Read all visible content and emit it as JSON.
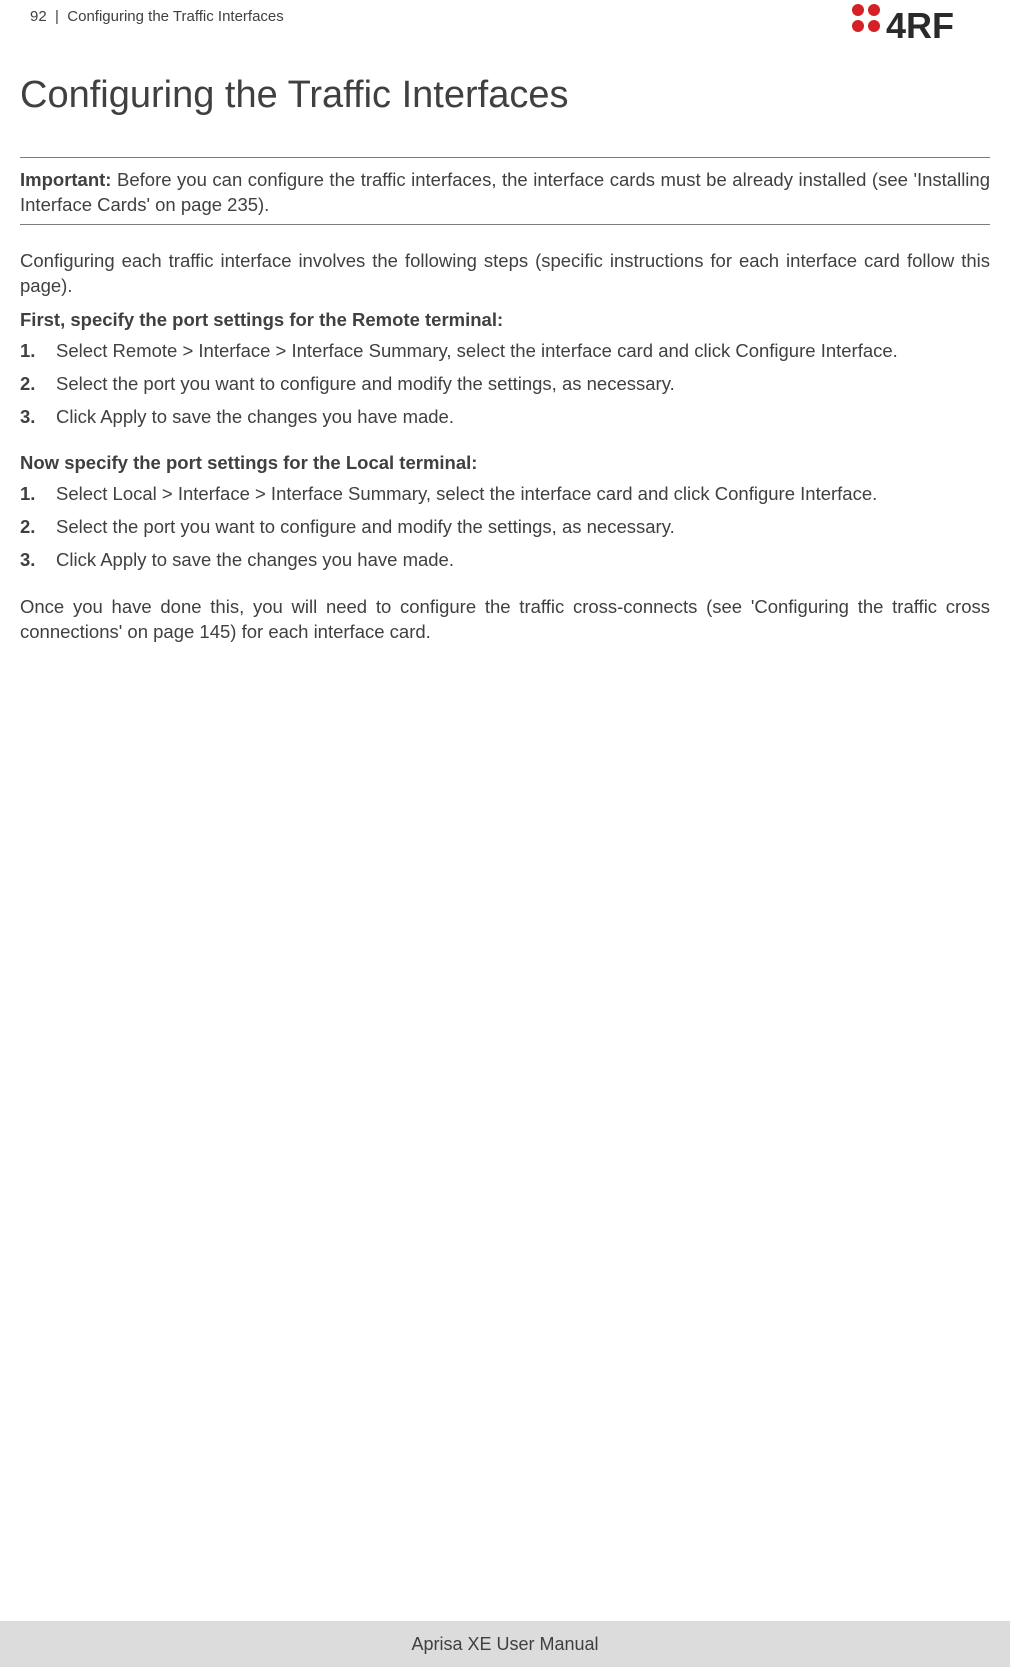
{
  "header": {
    "page_number": "92",
    "section_title": "Configuring the Traffic Interfaces",
    "brand": "4RF"
  },
  "title": "Configuring the Traffic Interfaces",
  "callout": {
    "label": "Important:",
    "text": " Before you can configure the traffic interfaces, the interface cards must be already installed (see 'Installing Interface Cards' on page 235)."
  },
  "lead": "Configuring each traffic interface involves the following steps (specific instructions for each interface card follow this page).",
  "remote": {
    "heading": "First, specify the port settings for the Remote terminal:",
    "steps": [
      "Select Remote > Interface > Interface Summary, select the interface card and click Configure Interface.",
      "Select the port you want to configure and modify the settings, as necessary.",
      "Click Apply to save the changes you have made."
    ]
  },
  "local": {
    "heading": "Now specify the port settings for the Local terminal:",
    "steps": [
      "Select Local > Interface > Interface Summary, select the interface card and click Configure Interface.",
      "Select the port you want to configure and modify the settings, as necessary.",
      "Click Apply to save the changes you have made."
    ]
  },
  "closing": "Once you have done this, you will need to configure the traffic cross-connects (see 'Configuring the traffic cross connections' on page 145) for each interface card.",
  "footer": "Aprisa XE User Manual"
}
